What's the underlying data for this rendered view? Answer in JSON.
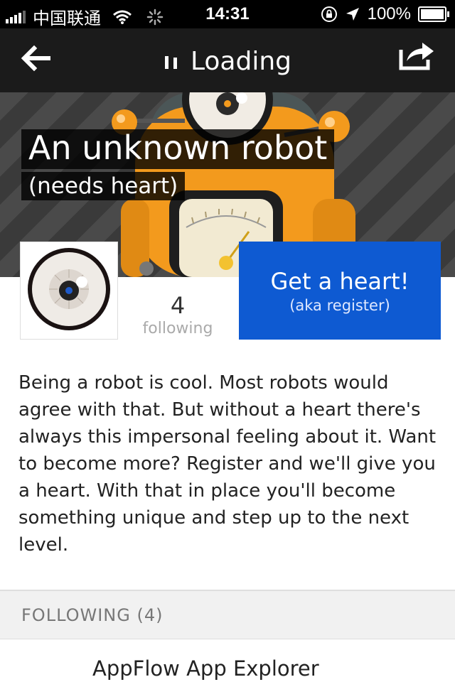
{
  "status_bar": {
    "carrier": "中国联通",
    "time": "14:31",
    "battery": "100%"
  },
  "nav": {
    "title": "Loading",
    "back_icon": "back-arrow-icon",
    "share_icon": "share-icon"
  },
  "profile": {
    "name": "An unknown robot",
    "subtitle": "(needs heart)",
    "following_count": "4",
    "following_label": "following",
    "register_title": "Get a heart!",
    "register_subtitle": "(aka register)",
    "bio": "Being a robot is cool. Most robots would agree with that. But without a heart there's always this impersonal feeling about it. Want to become more? Register and we'll give you a heart. With that in place you'll become something unique and step up to the next level."
  },
  "following_section": {
    "header": "FOLLOWING (4)",
    "items": [
      {
        "name": "AppFlow App Explorer"
      }
    ]
  },
  "colors": {
    "accent": "#0e5ad2",
    "robot_orange": "#f39a1d",
    "navbar": "#1b1b1b"
  }
}
